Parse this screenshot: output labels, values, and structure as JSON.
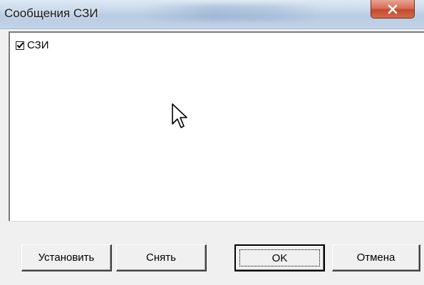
{
  "window": {
    "title": "Сообщения СЗИ",
    "close_glyph": "X"
  },
  "list": {
    "items": [
      {
        "label": "СЗИ",
        "checked": true
      }
    ]
  },
  "buttons": {
    "set_label": "Установить",
    "clear_label": "Снять",
    "ok_label": "OK",
    "cancel_label": "Отмена"
  }
}
